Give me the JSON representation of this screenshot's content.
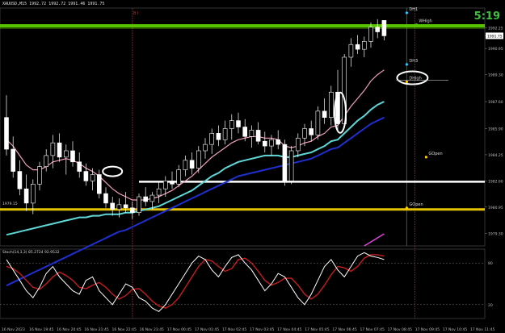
{
  "header": {
    "symbol_line": "XAUUSD,M15  1992.72 1992.72 1991.46 1991.75",
    "timer": "5:19",
    "panel_tag": "B I"
  },
  "colors": {
    "background": "#000000",
    "candle": "#ffffff",
    "grid": "#3a3a3a",
    "price_line": "#58c400",
    "support_line": "#ffffff",
    "yellow_level": "#e6c300",
    "ma_fast": "#f0a0b8",
    "ma_mid": "#5fd7d7",
    "ma_slow": "#1f2fd0",
    "ma_magenta": "#e040e0",
    "stoch_main": "#ffffff",
    "stoch_signal": "#c41e1e",
    "vline_red": "#a01010",
    "vline_green": "#1e6e1e",
    "marker_dot": "#ffcc00",
    "marker_dot_blue": "#35c5ff"
  },
  "chart_data": {
    "type": "candlestick",
    "symbol": "XAUUSD",
    "timeframe": "M15",
    "ylim": [
      1978.5,
      1993.5
    ],
    "price_ticks": [
      1992.25,
      1991.75,
      1990.95,
      1989.3,
      1987.6,
      1985.9,
      1984.25,
      1982.6,
      1980.95,
      1979.3
    ],
    "current_price": 1991.75,
    "price_labels": [
      "1992.25",
      "1991.75",
      "1990.95",
      "1989.30",
      "1987.60",
      "1985.90",
      "1984.25",
      "1982.60",
      "1980.95",
      "1979.30"
    ],
    "time_labels": [
      "16 Nov 2023",
      "16 Nov 19:45",
      "16 Nov 20:45",
      "16 Nov 21:45",
      "16 Nov 22:45",
      "16 Nov 23:45",
      "17 Nov 00:45",
      "17 Nov 01:45",
      "17 Nov 02:45",
      "17 Nov 03:45",
      "17 Nov 04:45",
      "17 Nov 05:45",
      "17 Nov 06:45",
      "17 Nov 07:45",
      "17 Nov 08:45",
      "17 Nov 09:45",
      "17 Nov 10:45",
      "17 Nov 11:45"
    ],
    "candles": [
      {
        "o": 1986.6,
        "h": 1988.0,
        "l": 1984.2,
        "c": 1984.6
      },
      {
        "o": 1984.6,
        "h": 1985.4,
        "l": 1982.8,
        "c": 1983.2
      },
      {
        "o": 1983.2,
        "h": 1983.9,
        "l": 1981.7,
        "c": 1982.1
      },
      {
        "o": 1982.1,
        "h": 1983.0,
        "l": 1980.7,
        "c": 1981.2
      },
      {
        "o": 1981.2,
        "h": 1982.7,
        "l": 1980.5,
        "c": 1982.4
      },
      {
        "o": 1982.4,
        "h": 1983.8,
        "l": 1982.0,
        "c": 1983.5
      },
      {
        "o": 1983.5,
        "h": 1984.6,
        "l": 1983.2,
        "c": 1984.2
      },
      {
        "o": 1984.2,
        "h": 1985.5,
        "l": 1983.4,
        "c": 1985.0
      },
      {
        "o": 1985.0,
        "h": 1985.6,
        "l": 1983.8,
        "c": 1984.1
      },
      {
        "o": 1984.1,
        "h": 1984.9,
        "l": 1983.0,
        "c": 1984.5
      },
      {
        "o": 1984.5,
        "h": 1985.1,
        "l": 1983.5,
        "c": 1983.8
      },
      {
        "o": 1983.8,
        "h": 1984.4,
        "l": 1982.8,
        "c": 1983.2
      },
      {
        "o": 1983.2,
        "h": 1983.7,
        "l": 1982.3,
        "c": 1982.6
      },
      {
        "o": 1982.6,
        "h": 1983.4,
        "l": 1982.0,
        "c": 1983.0
      },
      {
        "o": 1983.0,
        "h": 1983.3,
        "l": 1981.5,
        "c": 1981.8
      },
      {
        "o": 1981.8,
        "h": 1982.2,
        "l": 1980.9,
        "c": 1981.2
      },
      {
        "o": 1981.2,
        "h": 1981.6,
        "l": 1980.4,
        "c": 1980.8
      },
      {
        "o": 1980.8,
        "h": 1981.5,
        "l": 1980.3,
        "c": 1981.1
      },
      {
        "o": 1981.1,
        "h": 1981.9,
        "l": 1980.6,
        "c": 1980.9
      },
      {
        "o": 1980.9,
        "h": 1981.3,
        "l": 1980.2,
        "c": 1980.6
      },
      {
        "o": 1980.6,
        "h": 1981.8,
        "l": 1980.4,
        "c": 1981.6
      },
      {
        "o": 1981.6,
        "h": 1982.2,
        "l": 1981.0,
        "c": 1981.3
      },
      {
        "o": 1981.3,
        "h": 1981.9,
        "l": 1980.8,
        "c": 1981.7
      },
      {
        "o": 1981.7,
        "h": 1982.5,
        "l": 1981.2,
        "c": 1982.1
      },
      {
        "o": 1982.1,
        "h": 1982.9,
        "l": 1981.6,
        "c": 1982.6
      },
      {
        "o": 1982.6,
        "h": 1983.2,
        "l": 1982.1,
        "c": 1982.4
      },
      {
        "o": 1982.4,
        "h": 1983.6,
        "l": 1982.2,
        "c": 1983.3
      },
      {
        "o": 1983.3,
        "h": 1984.2,
        "l": 1982.9,
        "c": 1983.9
      },
      {
        "o": 1983.9,
        "h": 1984.4,
        "l": 1983.0,
        "c": 1983.4
      },
      {
        "o": 1983.4,
        "h": 1984.8,
        "l": 1983.1,
        "c": 1984.5
      },
      {
        "o": 1984.5,
        "h": 1985.3,
        "l": 1984.0,
        "c": 1984.9
      },
      {
        "o": 1984.9,
        "h": 1985.9,
        "l": 1984.3,
        "c": 1985.6
      },
      {
        "o": 1985.6,
        "h": 1986.1,
        "l": 1984.8,
        "c": 1985.2
      },
      {
        "o": 1985.2,
        "h": 1986.4,
        "l": 1984.9,
        "c": 1985.9
      },
      {
        "o": 1985.9,
        "h": 1986.8,
        "l": 1985.2,
        "c": 1986.4
      },
      {
        "o": 1986.4,
        "h": 1986.9,
        "l": 1985.6,
        "c": 1986.0
      },
      {
        "o": 1986.0,
        "h": 1986.5,
        "l": 1985.1,
        "c": 1985.4
      },
      {
        "o": 1985.4,
        "h": 1986.1,
        "l": 1984.7,
        "c": 1985.8
      },
      {
        "o": 1985.8,
        "h": 1986.3,
        "l": 1984.9,
        "c": 1985.1
      },
      {
        "o": 1985.1,
        "h": 1985.7,
        "l": 1984.4,
        "c": 1984.8
      },
      {
        "o": 1984.8,
        "h": 1985.5,
        "l": 1984.2,
        "c": 1985.2
      },
      {
        "o": 1985.2,
        "h": 1985.8,
        "l": 1984.6,
        "c": 1984.9
      },
      {
        "o": 1984.9,
        "h": 1985.2,
        "l": 1982.3,
        "c": 1982.6
      },
      {
        "o": 1982.6,
        "h": 1984.8,
        "l": 1982.4,
        "c": 1984.5
      },
      {
        "o": 1984.5,
        "h": 1985.6,
        "l": 1984.1,
        "c": 1985.3
      },
      {
        "o": 1985.3,
        "h": 1986.2,
        "l": 1984.8,
        "c": 1985.9
      },
      {
        "o": 1985.9,
        "h": 1986.4,
        "l": 1985.1,
        "c": 1985.5
      },
      {
        "o": 1985.5,
        "h": 1987.3,
        "l": 1985.2,
        "c": 1987.0
      },
      {
        "o": 1987.0,
        "h": 1987.8,
        "l": 1986.2,
        "c": 1986.6
      },
      {
        "o": 1986.6,
        "h": 1988.6,
        "l": 1986.1,
        "c": 1988.2
      },
      {
        "o": 1988.2,
        "h": 1989.6,
        "l": 1985.8,
        "c": 1986.2
      },
      {
        "o": 1986.2,
        "h": 1990.6,
        "l": 1986.0,
        "c": 1990.4
      },
      {
        "o": 1990.4,
        "h": 1991.6,
        "l": 1989.8,
        "c": 1991.2
      },
      {
        "o": 1991.2,
        "h": 1991.8,
        "l": 1990.6,
        "c": 1990.9
      },
      {
        "o": 1990.9,
        "h": 1991.7,
        "l": 1990.4,
        "c": 1991.4
      },
      {
        "o": 1991.4,
        "h": 1992.6,
        "l": 1991.0,
        "c": 1992.3
      },
      {
        "o": 1992.3,
        "h": 1992.8,
        "l": 1991.6,
        "c": 1992.0
      },
      {
        "o": 1992.72,
        "h": 1992.72,
        "l": 1991.46,
        "c": 1991.75
      }
    ],
    "ma_fast": [
      1985.2,
      1984.8,
      1984.2,
      1983.6,
      1983.3,
      1983.3,
      1983.5,
      1983.8,
      1983.9,
      1984.0,
      1983.9,
      1983.7,
      1983.4,
      1983.2,
      1982.9,
      1982.5,
      1982.1,
      1981.8,
      1981.6,
      1981.4,
      1981.4,
      1981.4,
      1981.5,
      1981.6,
      1981.8,
      1982.0,
      1982.3,
      1982.6,
      1982.9,
      1983.3,
      1983.7,
      1984.1,
      1984.4,
      1984.7,
      1985.0,
      1985.2,
      1985.3,
      1985.4,
      1985.4,
      1985.3,
      1985.3,
      1985.2,
      1984.8,
      1984.7,
      1984.8,
      1985.0,
      1985.1,
      1985.4,
      1985.6,
      1986.0,
      1986.1,
      1986.7,
      1987.3,
      1987.8,
      1988.3,
      1988.9,
      1989.3,
      1989.6
    ],
    "ma_mid": [
      1979.2,
      1979.3,
      1979.4,
      1979.5,
      1979.6,
      1979.7,
      1979.8,
      1979.9,
      1980.0,
      1980.1,
      1980.2,
      1980.3,
      1980.3,
      1980.4,
      1980.4,
      1980.5,
      1980.5,
      1980.5,
      1980.6,
      1980.6,
      1980.7,
      1980.8,
      1980.9,
      1981.0,
      1981.2,
      1981.4,
      1981.6,
      1981.8,
      1982.0,
      1982.3,
      1982.6,
      1982.9,
      1983.1,
      1983.4,
      1983.6,
      1983.8,
      1983.9,
      1984.0,
      1984.1,
      1984.2,
      1984.2,
      1984.2,
      1984.1,
      1984.1,
      1984.2,
      1984.3,
      1984.4,
      1984.6,
      1984.8,
      1985.1,
      1985.2,
      1985.6,
      1986.0,
      1986.4,
      1986.7,
      1987.1,
      1987.4,
      1987.6
    ],
    "ma_slow": [
      1976.0,
      1976.2,
      1976.4,
      1976.6,
      1976.8,
      1977.0,
      1977.2,
      1977.4,
      1977.6,
      1977.8,
      1978.0,
      1978.2,
      1978.4,
      1978.6,
      1978.8,
      1979.0,
      1979.2,
      1979.4,
      1979.5,
      1979.7,
      1979.9,
      1980.1,
      1980.3,
      1980.5,
      1980.7,
      1980.9,
      1981.1,
      1981.3,
      1981.5,
      1981.7,
      1981.9,
      1982.1,
      1982.3,
      1982.5,
      1982.7,
      1982.9,
      1983.0,
      1983.1,
      1983.2,
      1983.3,
      1983.4,
      1983.5,
      1983.6,
      1983.7,
      1983.8,
      1983.9,
      1984.0,
      1984.2,
      1984.4,
      1984.6,
      1984.7,
      1985.0,
      1985.3,
      1985.6,
      1985.9,
      1986.2,
      1986.4,
      1986.6
    ],
    "stoch": {
      "label": "Stoch(14,3,3) 85.2724 92.9532",
      "levels": [
        80,
        20
      ],
      "main": [
        85,
        70,
        55,
        40,
        30,
        45,
        65,
        75,
        60,
        50,
        40,
        35,
        55,
        60,
        40,
        30,
        20,
        35,
        50,
        45,
        30,
        25,
        15,
        10,
        20,
        35,
        50,
        65,
        80,
        90,
        85,
        70,
        60,
        75,
        88,
        92,
        80,
        70,
        55,
        40,
        50,
        65,
        60,
        45,
        30,
        20,
        35,
        55,
        75,
        85,
        70,
        60,
        75,
        90,
        95,
        90,
        88,
        85
      ],
      "signal": [
        75,
        72,
        65,
        55,
        45,
        42,
        50,
        60,
        67,
        62,
        55,
        45,
        43,
        48,
        52,
        45,
        35,
        28,
        33,
        42,
        43,
        35,
        25,
        18,
        15,
        20,
        30,
        45,
        60,
        75,
        85,
        83,
        75,
        68,
        72,
        85,
        87,
        80,
        68,
        55,
        48,
        52,
        58,
        58,
        48,
        35,
        28,
        35,
        48,
        63,
        75,
        73,
        68,
        75,
        87,
        92,
        92,
        90
      ]
    },
    "levels": [
      {
        "name": "support",
        "value": 1982.55
      },
      {
        "name": "yellow",
        "value": 1980.8
      }
    ],
    "annotations": [
      "DH1",
      "WHigh",
      "DH3",
      "DHigh",
      "GOpen",
      "GOpen"
    ],
    "vertical_markers": [
      "16 Nov 23:45",
      "17 Nov 11:45"
    ],
    "yellow_level_label": "1979.15"
  }
}
